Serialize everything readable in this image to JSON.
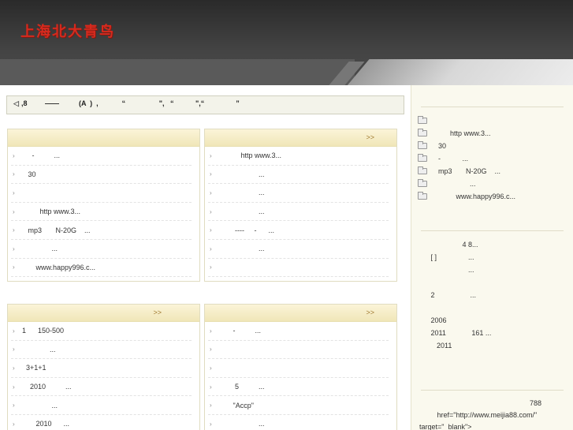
{
  "header": {
    "logo": "上海北大青鸟"
  },
  "notice": {
    "text": ",8         ——          (A  )  ,            “                 \",   “           \",“                ”"
  },
  "boxes": [
    {
      "more": "",
      "items": [
        "     -          ...",
        "   30",
        "",
        "         http www.3...",
        "   mp3       N-20G    ...",
        "               ...",
        "       www.happy996.c...",
        "      ,     ,   ..."
      ]
    },
    {
      "more": ">>",
      "items": [
        "           http www.3...",
        "                    ...",
        "                    ...",
        "                    ...",
        "        ----     -      ...",
        "                    ...",
        "",
        "                 -  ..."
      ]
    },
    {
      "more": ">>",
      "items": [
        "1      150-500",
        "              ...",
        "  3+1+1",
        "    2010          ...",
        "               ...",
        "       2010      ..."
      ]
    },
    {
      "more": ">>",
      "items": [
        "       -          ...",
        "",
        "",
        "        5          ...",
        "       \"Accp\"",
        "                    ..."
      ]
    }
  ],
  "sidebar": {
    "list": [
      "",
      "      http www.3...",
      "30",
      "-           ...",
      "mp3       N-20G    ...",
      "                ...",
      "         www.happy996.c..."
    ],
    "text": "                     4 8...\n     [ ]                ...\n                        ...\n\n     2                  ...\n\n     2006\n     2011             161 ...\n        2011",
    "foot": "                                                        788\n         href=\"http://www.meijia88.com/\"\ntarget=\"_blank\">"
  }
}
